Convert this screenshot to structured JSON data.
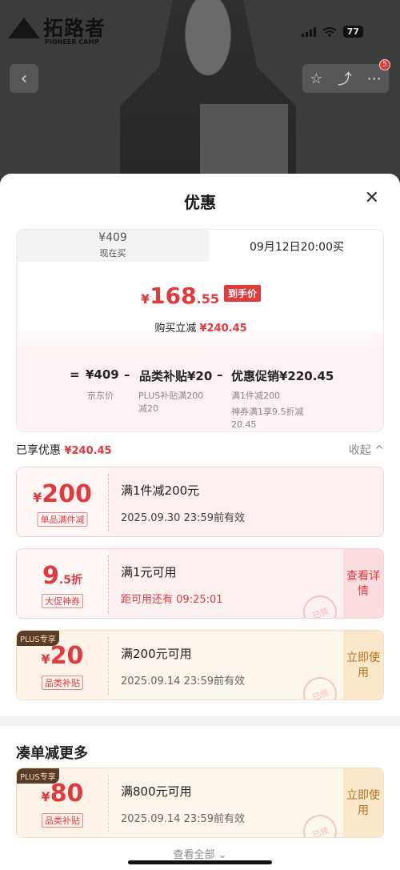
{
  "status_bar": {
    "battery": "77"
  },
  "brand": {
    "title": "拓路者",
    "subtitle": "PIONEER CAMP"
  },
  "nav": {
    "back_icon": "chevron-left-icon",
    "badge": "5"
  },
  "sheet": {
    "title": "优惠",
    "close_icon": "close-icon"
  },
  "price_tabs": {
    "now_price": "¥409",
    "now_label": "现在买",
    "future_label": "09月12日20:00买"
  },
  "final_price": {
    "yen": "¥",
    "integer": "168",
    "decimal": ".55",
    "tag": "到手价",
    "reduce_label": "购买立减",
    "reduce_value": "¥240.45"
  },
  "formula": {
    "eq": "=",
    "jd_price": "¥409",
    "minus1": "–",
    "category_subsidy": "品类补贴¥20",
    "minus2": "–",
    "promo": "优惠促销¥220.45",
    "jd_price_label": "京东价",
    "category_detail": "PLUS补贴满200减20",
    "promo_detail_1": "满1件减200",
    "promo_detail_2": "神券满1享9.5折减20.45"
  },
  "enjoyed": {
    "label": "已享优惠",
    "value": "¥240.45",
    "collapse": "收起 ^"
  },
  "coupons": [
    {
      "yen": "¥",
      "amount": "200",
      "tag": "单品满件减",
      "title": "满1件减200元",
      "sub": "2025.09.30 23:59前有效"
    },
    {
      "amount": "9",
      "suffix": ".5折",
      "tag": "大促神券",
      "title": "满1元可用",
      "sub": "距可用还有 09:25:01",
      "side": "查看详情",
      "stamp": "已领"
    },
    {
      "plus": "PLUS专享",
      "yen": "¥",
      "amount": "20",
      "tag": "品类补贴",
      "title": "满200元可用",
      "sub": "2025.09.14 23:59前有效",
      "side": "立即使用",
      "stamp": "已领"
    }
  ],
  "more": {
    "title": "凑单减更多",
    "coupon": {
      "plus": "PLUS专享",
      "yen": "¥",
      "amount": "80",
      "tag": "品类补贴",
      "title": "满800元可用",
      "sub": "2025.09.14 23:59前有效",
      "side": "立即使用",
      "stamp": "已领"
    },
    "view_all": "查看全部 ⌄"
  }
}
